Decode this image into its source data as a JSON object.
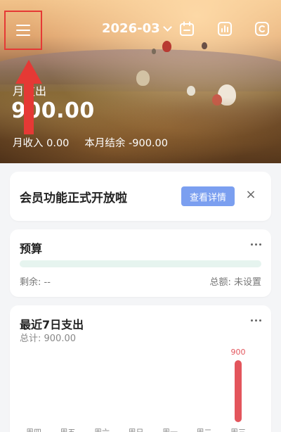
{
  "header": {
    "menu_icon": "hamburger-menu-icon",
    "date_label": "2026-03",
    "calendar_icon": "calendar-icon",
    "stats_icon": "bar-chart-icon",
    "extra_icon": "coin-icon"
  },
  "hero": {
    "spend_label": "月支出",
    "spend_value": "900.00",
    "income_label": "月收入 0.00",
    "balance_label": "本月结余 -900.00"
  },
  "promo": {
    "title": "会员功能正式开放啦",
    "button": "查看详情",
    "close": "×"
  },
  "budget": {
    "title": "预算",
    "remaining": "剩余: --",
    "total": "总额: 未设置",
    "bar_color": "#e6f4ef"
  },
  "weekly": {
    "title": "最近7日支出",
    "subtitle": "总计: 900.00"
  },
  "chart_data": {
    "type": "bar",
    "categories": [
      "周四",
      "周五",
      "周六",
      "周日",
      "周一",
      "周二",
      "周三"
    ],
    "values": [
      0,
      0,
      0,
      0,
      0,
      0,
      900
    ],
    "data_labels": [
      "",
      "",
      "",
      "",
      "",
      "",
      "900"
    ],
    "bar_color": "#e3555c",
    "ylim": [
      0,
      900
    ],
    "grid": false
  },
  "colors": {
    "accent": "#7b9ff0",
    "highlight": "#e53935"
  }
}
